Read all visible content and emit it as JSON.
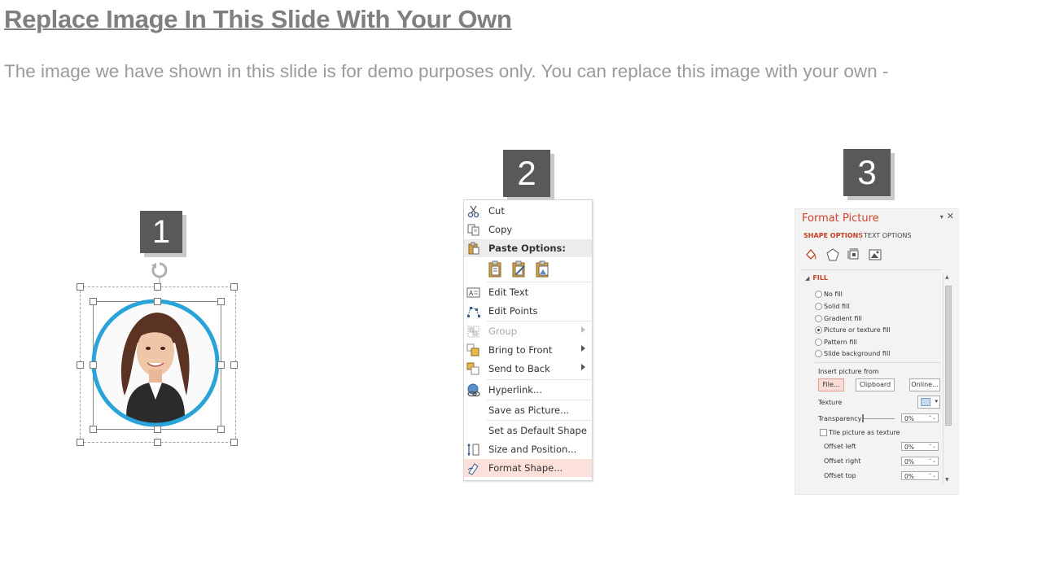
{
  "slide": {
    "title": "Replace Image In This Slide With Your Own",
    "description": "The image we have shown in this slide is for demo purposes only. You can replace this image with your own -"
  },
  "steps": [
    "1",
    "2",
    "3"
  ],
  "context_menu": {
    "items": [
      {
        "label": "Cut",
        "icon": "scissors-icon"
      },
      {
        "label": "Copy",
        "icon": "copy-icon"
      },
      {
        "label": "Paste Options:",
        "icon": "paste-icon"
      },
      {
        "label": "Edit Text",
        "icon": "edit-text-icon"
      },
      {
        "label": "Edit Points",
        "icon": "edit-points-icon"
      },
      {
        "label": "Group",
        "icon": "group-icon",
        "disabled": true,
        "submenu": true
      },
      {
        "label": "Bring to Front",
        "icon": "bring-to-front-icon",
        "submenu": true
      },
      {
        "label": "Send to Back",
        "icon": "send-to-back-icon",
        "submenu": true
      },
      {
        "label": "Hyperlink...",
        "icon": "hyperlink-icon"
      },
      {
        "label": "Save as Picture...",
        "icon": ""
      },
      {
        "label": "Set as Default Shape",
        "icon": ""
      },
      {
        "label": "Size and Position...",
        "icon": "size-position-icon"
      },
      {
        "label": "Format Shape...",
        "icon": "format-shape-icon",
        "highlighted": true
      }
    ]
  },
  "format_pane": {
    "title": "Format Picture",
    "close": "✕",
    "tabs": [
      "SHAPE OPTIONS",
      "TEXT OPTIONS"
    ],
    "section": "FILL",
    "fill_options": [
      {
        "label": "No fill",
        "checked": false
      },
      {
        "label": "Solid fill",
        "checked": false
      },
      {
        "label": "Gradient fill",
        "checked": false
      },
      {
        "label": "Picture or texture fill",
        "checked": true
      },
      {
        "label": "Pattern fill",
        "checked": false
      },
      {
        "label": "Slide background fill",
        "checked": false
      }
    ],
    "insert_from": "Insert picture from",
    "buttons": [
      "File...",
      "Clipboard",
      "Online..."
    ],
    "texture_label": "Texture",
    "transparency_label": "Transparency",
    "transparency_value": "0%",
    "tile_label": "Tile picture as texture",
    "offsets": [
      {
        "label": "Offset left",
        "value": "0%"
      },
      {
        "label": "Offset right",
        "value": "0%"
      },
      {
        "label": "Offset top",
        "value": "0%"
      }
    ]
  },
  "colors": {
    "accent_blue": "#29a3d8",
    "highlight": "#fbe1da",
    "step_box": "#595959",
    "pane_title": "#d0432b"
  }
}
